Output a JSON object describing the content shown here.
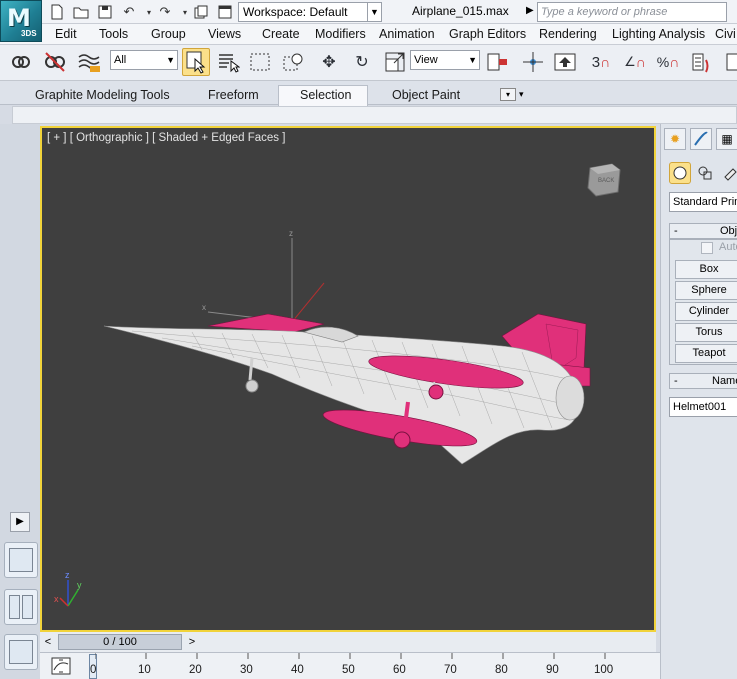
{
  "app": {
    "logo_label": "3DS",
    "logo_glyph": "M"
  },
  "titlebar": {
    "workspace_label": "Workspace: Default",
    "file_name": "Airplane_015.max",
    "search_placeholder": "Type a keyword or phrase",
    "quick_access_icons": [
      "new-file-icon",
      "open-folder-icon",
      "save-icon",
      "undo-icon",
      "redo-icon",
      "project-icon",
      "window-icon"
    ]
  },
  "menu": {
    "items": [
      "Edit",
      "Tools",
      "Group",
      "Views",
      "Create",
      "Modifiers",
      "Animation",
      "Graph Editors",
      "Rendering",
      "Lighting Analysis",
      "Civi"
    ]
  },
  "toolbar": {
    "selection_filter": "All",
    "reference_coord": "View",
    "labels": {
      "snap_3": "3",
      "angle_snap": "%"
    }
  },
  "ribbon": {
    "tabs": [
      "Graphite Modeling Tools",
      "Freeform",
      "Selection",
      "Object Paint"
    ],
    "active_tab": "Selection"
  },
  "viewport": {
    "label": "[ + ] [ Orthographic ] [ Shaded + Edged Faces ]",
    "viewcube_label": "BACK",
    "gizmo_labels": {
      "z": "z",
      "x": "x"
    },
    "border_color": "#f1d33a",
    "background": "#3f3f3f",
    "model_colors": {
      "body": "#e6e6e6",
      "accent": "#e0307a"
    }
  },
  "command_panel": {
    "category": "Standard Primitives",
    "object_type_title": "Object Type",
    "autogrid_label": "AutoGrid",
    "primitives": [
      "Box",
      "Sphere",
      "Cylinder",
      "Torus",
      "Teapot"
    ],
    "name_color_title": "Name and Color",
    "object_name": "Helmet001"
  },
  "timeline": {
    "frame_display": "0 / 100",
    "ticks": [
      "0",
      "10",
      "20",
      "30",
      "40",
      "50",
      "60",
      "70",
      "80",
      "90",
      "100"
    ]
  }
}
